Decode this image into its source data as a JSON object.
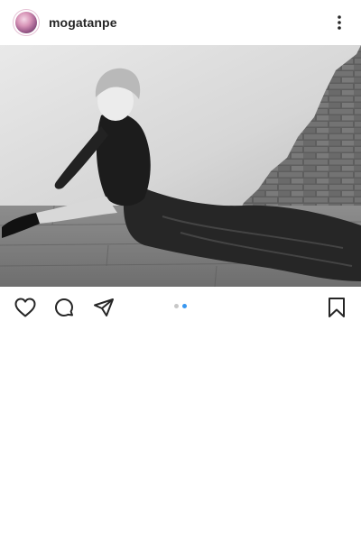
{
  "header": {
    "username": "mogatanpe",
    "avatar_icon": "profile-avatar",
    "more_icon": "more-vertical-icon"
  },
  "post": {
    "image_description_icon": "photo",
    "carousel": {
      "total": 2,
      "active_index": 1,
      "active_color": "#3897f0",
      "inactive_color": "#c7c7c7"
    }
  },
  "actions": {
    "like_icon": "heart-icon",
    "comment_icon": "comment-icon",
    "share_icon": "paper-plane-icon",
    "save_icon": "bookmark-icon"
  }
}
